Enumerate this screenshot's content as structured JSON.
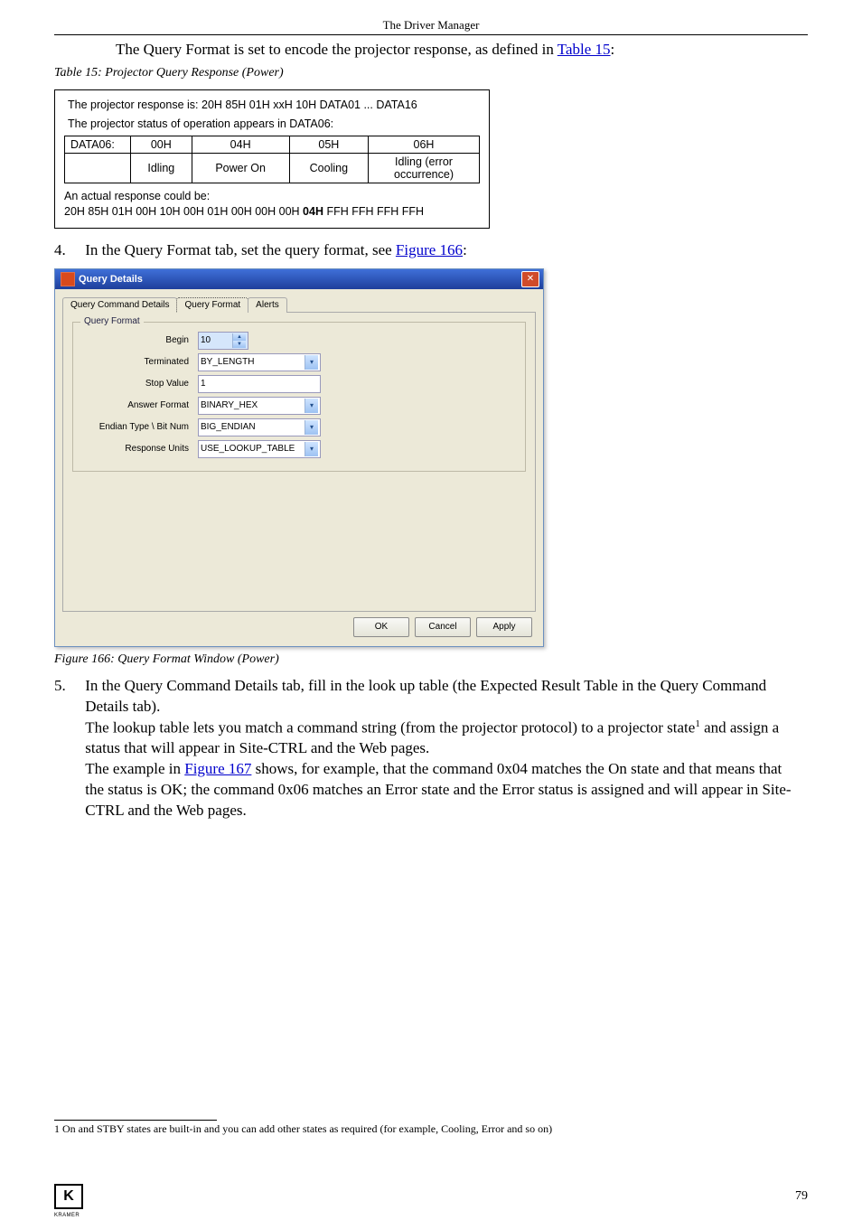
{
  "header": {
    "title": "The Driver Manager"
  },
  "intro": {
    "prefix": "The Query Format is set to encode the projector response, as defined in ",
    "link": "Table 15",
    "suffix": ":"
  },
  "table_caption": "Table 15: Projector Query Response (Power)",
  "proj_table": {
    "line1": "The projector response is: 20H 85H 01H xxH 10H DATA01 ... DATA16",
    "line2": "The projector status of operation appears in DATA06:",
    "header_row": [
      "DATA06:",
      "00H",
      "04H",
      "05H",
      "06H"
    ],
    "data_row": [
      "",
      "Idling",
      "Power On",
      "Cooling",
      "Idling (error occurrence)"
    ],
    "foot1": "An actual response could be:",
    "foot2_a": "20H 85H 01H 00H 10H 00H 01H 00H 00H 00H ",
    "foot2_b": "04H",
    "foot2_c": " FFH FFH FFH FFH"
  },
  "step4": {
    "num": "4.",
    "prefix": "In the Query Format tab, set the query format, see ",
    "link": "Figure 166",
    "suffix": ":"
  },
  "dialog": {
    "title": "Query Details",
    "tabs": [
      "Query Command Details",
      "Query Format",
      "Alerts"
    ],
    "legend": "Query Format",
    "rows": {
      "begin": {
        "label": "Begin",
        "value": "10"
      },
      "terminated": {
        "label": "Terminated",
        "value": "BY_LENGTH"
      },
      "stop_value": {
        "label": "Stop Value",
        "value": "1"
      },
      "answer_format": {
        "label": "Answer Format",
        "value": "BINARY_HEX"
      },
      "endian": {
        "label": "Endian Type \\ Bit Num",
        "value": "BIG_ENDIAN"
      },
      "response_units": {
        "label": "Response Units",
        "value": "USE_LOOKUP_TABLE"
      }
    },
    "buttons": {
      "ok": "OK",
      "cancel": "Cancel",
      "apply": "Apply"
    }
  },
  "fig_caption": "Figure 166: Query Format Window (Power)",
  "step5": {
    "num": "5.",
    "p1": "In the Query Command Details tab, fill in the look up table (the Expected Result Table in the Query Command Details tab).",
    "p2a": "The lookup table lets you match a command string (from the projector protocol) to a projector state",
    "p2b": " and assign a status that will appear in Site-CTRL and the Web pages.",
    "p3a": "The example in ",
    "p3link": "Figure 167",
    "p3b": " shows, for example, that the command 0x04 matches the On state and that means that the status is OK; the command 0x06 matches an Error state and the Error status is assigned and will appear in Site-CTRL and the Web pages."
  },
  "footnote": {
    "num": "1",
    "text": " On and STBY states are built-in and you can add other states as required (for example, Cooling, Error and so on)"
  },
  "page_number": "79",
  "logo_text": "K",
  "logo_sub": "KRAMER"
}
